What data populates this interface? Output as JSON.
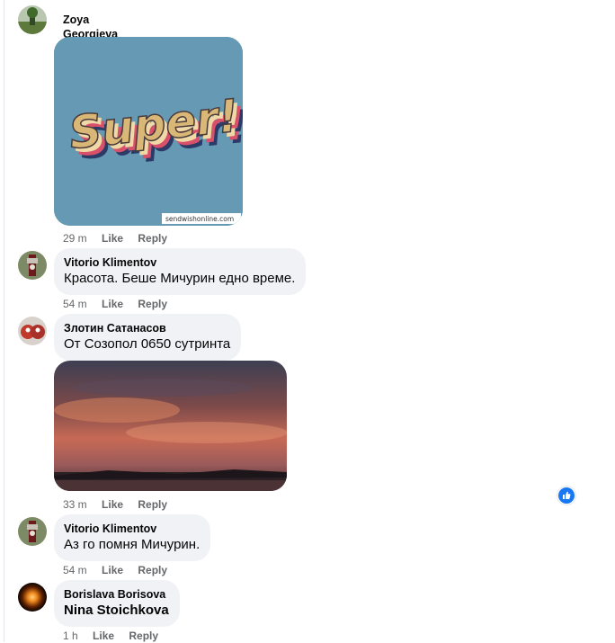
{
  "comments": [
    {
      "author": "Zoya Georgieva",
      "sticker": {
        "text": "Super!",
        "watermark": "sendwishonline.com"
      },
      "time": "29 m",
      "like": "Like",
      "reply": "Reply"
    },
    {
      "author": "Vitorio Klimentov",
      "text": "Красота. Беше Мичурин едно време.",
      "time": "54 m",
      "like": "Like",
      "reply": "Reply"
    },
    {
      "author": "Злотин Сатанасов",
      "text": "От Созопол 0650 сутринта",
      "time": "33 m",
      "like": "Like",
      "reply": "Reply"
    },
    {
      "author": "Vitorio Klimentov",
      "text": "Аз го помня Мичурин.",
      "time": "54 m",
      "like": "Like",
      "reply": "Reply"
    },
    {
      "author": "Borislava Borisova",
      "text": "Nina Stoichkova",
      "time": "1 h",
      "like": "Like",
      "reply": "Reply"
    }
  ],
  "colors": {
    "bubble": "#f0f2f5",
    "meta": "#65676b",
    "like_blue": "#1877f2"
  }
}
